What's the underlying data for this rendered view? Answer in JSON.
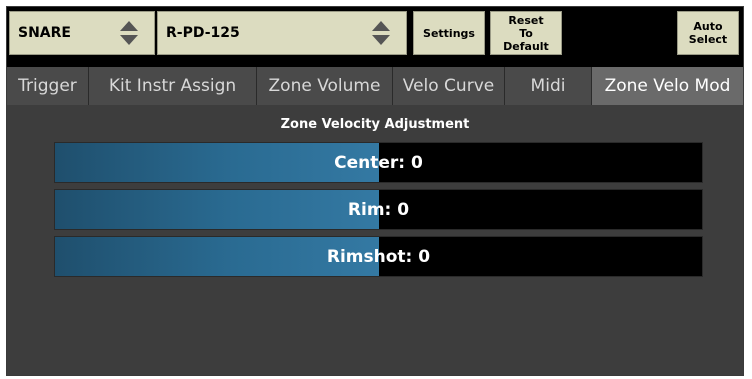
{
  "header": {
    "pad_select": {
      "value": "SNARE"
    },
    "trigger_select": {
      "value": "R-PD-125"
    },
    "settings_label": "Settings",
    "reset_label": "Reset\nTo\nDefault",
    "auto_select_label": "Auto\nSelect"
  },
  "tabs": [
    {
      "label": "Trigger",
      "active": false
    },
    {
      "label": "Kit Instr Assign",
      "active": false
    },
    {
      "label": "Zone Volume",
      "active": false
    },
    {
      "label": "Velo Curve",
      "active": false
    },
    {
      "label": "Midi",
      "active": false
    },
    {
      "label": "Zone Velo Mod",
      "active": true
    }
  ],
  "panel": {
    "title": "Zone Velocity Adjustment",
    "sliders": [
      {
        "label": "Center: 0",
        "level_fraction": 0.5
      },
      {
        "label": "Rim: 0",
        "level_fraction": 0.5
      },
      {
        "label": "Rimshot: 0",
        "level_fraction": 0.5
      }
    ]
  },
  "colors": {
    "slider_fill": "#2a6b92",
    "button_bg": "#dcdcc0",
    "panel_bg": "#3d3d3d"
  }
}
